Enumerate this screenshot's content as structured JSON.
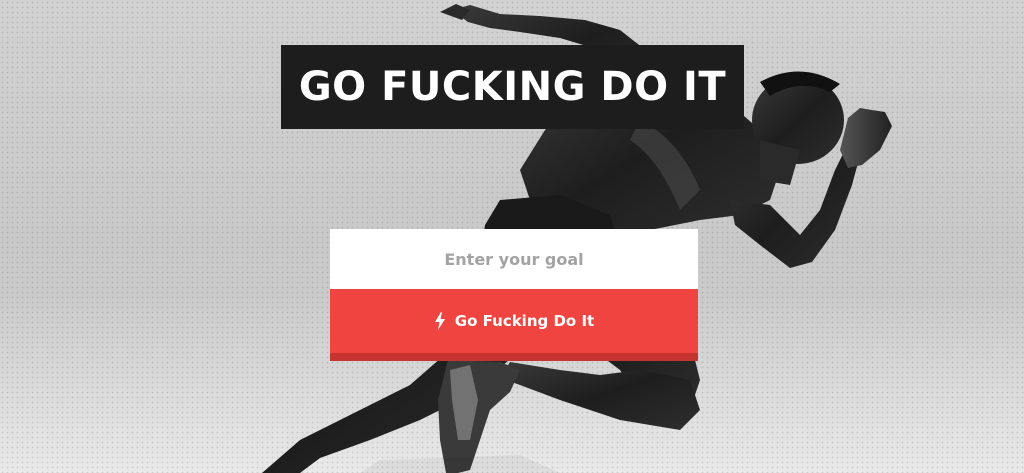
{
  "hero": {
    "headline": "GO FUCKING DO IT",
    "image": "sprinter-runner-photo"
  },
  "form": {
    "goal_placeholder": "Enter your goal",
    "goal_value": "",
    "submit_label": "Go Fucking Do It",
    "submit_icon": "lightning-bolt-icon"
  },
  "colors": {
    "headline_bg": "#1d1d1d",
    "button_bg": "#f04440",
    "button_shadow": "#c53431"
  }
}
